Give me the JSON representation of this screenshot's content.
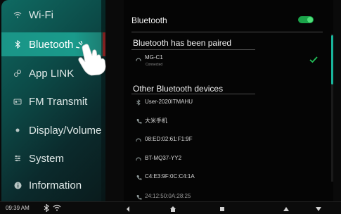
{
  "sidebar": {
    "items": [
      {
        "label": "Wi-Fi",
        "icon": "wifi-icon"
      },
      {
        "label": "Bluetooth",
        "icon": "bluetooth-icon"
      },
      {
        "label": "App LINK",
        "icon": "link-icon"
      },
      {
        "label": "FM Transmit",
        "icon": "radio-icon"
      },
      {
        "label": "Display/Volume",
        "icon": "display-icon"
      },
      {
        "label": "System",
        "icon": "system-icon"
      },
      {
        "label": "Information",
        "icon": "info-icon"
      }
    ]
  },
  "content": {
    "bluetooth_label": "Bluetooth",
    "bluetooth_enabled": true,
    "paired_header": "Bluetooth has been paired",
    "paired_devices": [
      {
        "name": "MG-C1",
        "status": "Connected"
      }
    ],
    "other_header": "Other Bluetooth devices",
    "other_devices": [
      {
        "name": "User-2020ITMAHU",
        "icon": "bluetooth-icon"
      },
      {
        "name": "大米手机",
        "icon": "phone-icon"
      },
      {
        "name": "08:ED:02:61:F1:9F",
        "icon": "headphones-icon"
      },
      {
        "name": "BT-MQ37-YY2",
        "icon": "headphones-icon"
      },
      {
        "name": "C4:E3:9F:0C:C4:1A",
        "icon": "phone-icon"
      },
      {
        "name": "24:12:50:0A:28:25",
        "icon": "phone-icon"
      }
    ]
  },
  "statusbar": {
    "time": "09:39 AM"
  },
  "colors": {
    "accent": "#1a9587",
    "toggle_on": "#1ba34a",
    "selection_marker": "#e23b3b"
  }
}
